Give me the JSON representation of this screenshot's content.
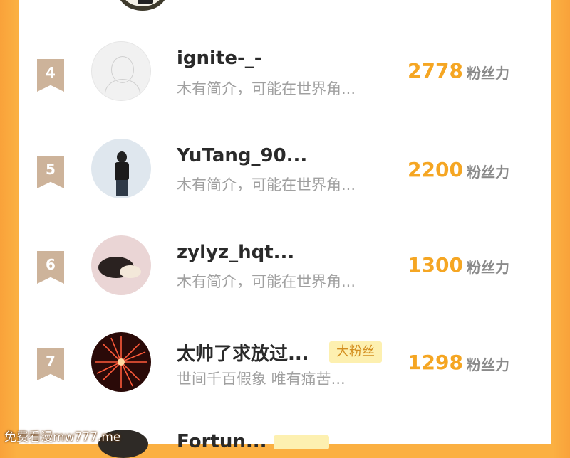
{
  "rows": [
    {
      "rank": "4",
      "name": "ignite-_-",
      "bio": "木有简介，可能在世界角...",
      "badge": "",
      "fans": "2778",
      "fans_label": "粉丝力"
    },
    {
      "rank": "5",
      "name": "YuTang_90...",
      "bio": "木有简介，可能在世界角...",
      "badge": "",
      "fans": "2200",
      "fans_label": "粉丝力"
    },
    {
      "rank": "6",
      "name": "zylyz_hqt...",
      "bio": "木有简介，可能在世界角...",
      "badge": "",
      "fans": "1300",
      "fans_label": "粉丝力"
    },
    {
      "rank": "7",
      "name": "太帅了求放过...",
      "bio": "世间千百假象 唯有痛苦...",
      "badge": "大粉丝",
      "fans": "1298",
      "fans_label": "粉丝力"
    }
  ],
  "next_row": {
    "name": "Fortun..."
  },
  "watermark": "免费看漫mw777.me",
  "colors": {
    "accent": "#f5a623",
    "rank_badge": "#cdb39a",
    "badge_bg": "#fdf0b0",
    "frame": "#fbb042"
  }
}
